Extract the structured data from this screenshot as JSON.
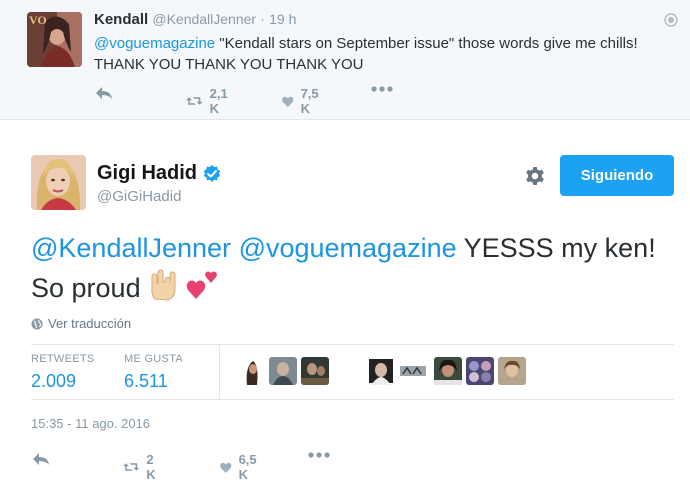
{
  "colors": {
    "accent": "#1da1f2",
    "link": "#1b95e0",
    "muted": "#8899a6",
    "text": "#292f33",
    "like_icon": "#a0b0bc"
  },
  "parent_tweet": {
    "name": "Kendall",
    "handle": "@KendallJenner",
    "separator": "·",
    "time": "19 h",
    "mention": "@voguemagazine",
    "text": " \"Kendall stars on September issue\" those words give me chills! THANK YOU THANK YOU THANK YOU",
    "actions": {
      "reply_icon": "reply-icon",
      "retweet_count": "2,1 K",
      "like_count": "7,5 K",
      "more_icon": "more-icon"
    }
  },
  "main_tweet": {
    "name": "Gigi Hadid",
    "handle": "@GiGiHadid",
    "verified_icon": "verified-badge-icon",
    "follow_button": "Siguiendo",
    "mention_1": "@KendallJenner",
    "mention_2": "@voguemagazine",
    "text": " YESSS my ken! So proud ",
    "emojis": [
      "rock-on-hand-emoji",
      "two-hearts-emoji"
    ],
    "translate_label": "Ver traducción",
    "stats": {
      "retweets_label": "RETWEETS",
      "retweets_value": "2.009",
      "likes_label": "ME GUSTA",
      "likes_value": "6.511"
    },
    "timestamp": "15:35 - 11 ago. 2016",
    "actions": {
      "retweet_count": "2 K",
      "like_count": "6,5 K"
    }
  }
}
